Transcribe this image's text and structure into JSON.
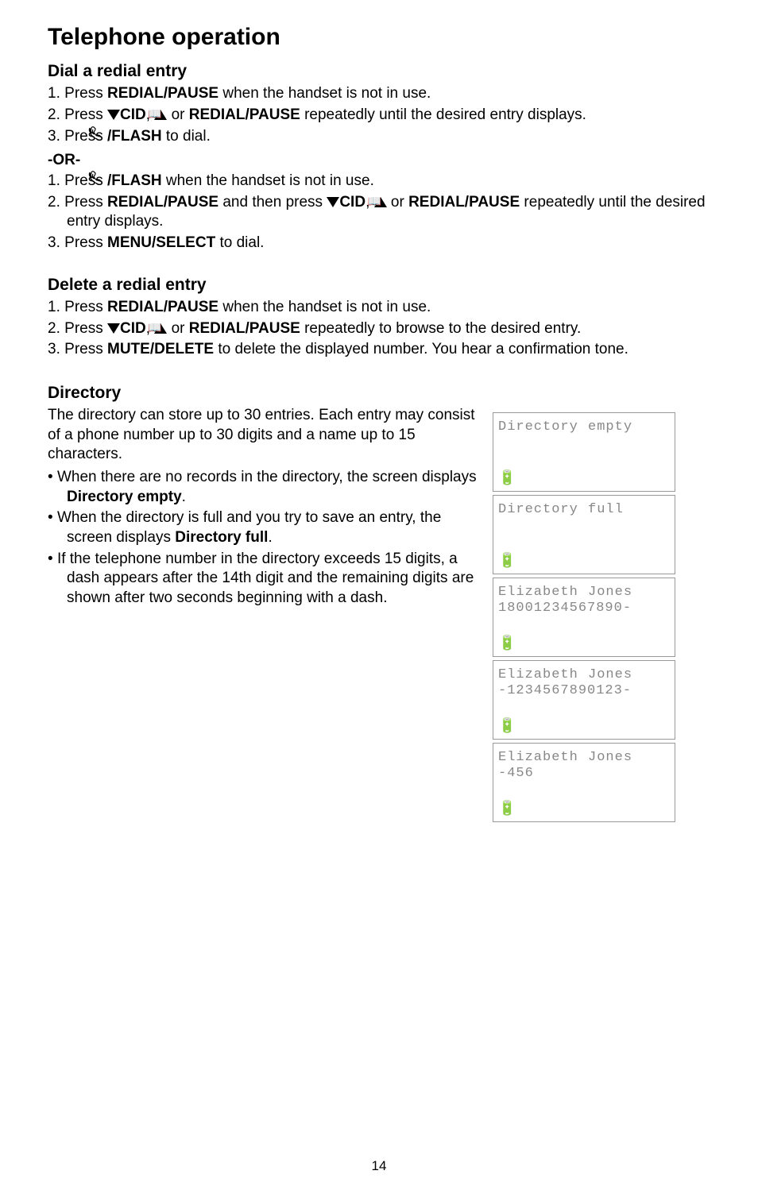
{
  "pageTitle": "Telephone operation",
  "sections": {
    "dialRedial": {
      "heading": "Dial a redial entry",
      "list1": [
        {
          "num": "1.",
          "pre": "Press ",
          "bold": "REDIAL/",
          "sc": "PAUSE",
          "post": " when the handset is not in use."
        },
        {
          "num": "2.",
          "pre": "Press ",
          "downArrow": true,
          "bold1": "CID",
          "mid": ", ",
          "upArrow": true,
          "book": true,
          "mid2": " or ",
          "bold2": "REDIAL/",
          "sc2": "PAUSE",
          "post": " repeatedly until the desired entry displays."
        },
        {
          "num": "3.",
          "pre": "Press ",
          "phone": true,
          "bold": "/",
          "sc": "FLASH",
          "post": " to dial."
        }
      ],
      "or": "-OR-",
      "list2": [
        {
          "num": "1.",
          "pre": "Press ",
          "phone": true,
          "bold": "/",
          "sc": "FLASH",
          "post": " when the handset is not in use."
        },
        {
          "num": "2.",
          "pre": "Press ",
          "bold": "REDIAL/",
          "sc": "PAUSE",
          "mid": " and then press ",
          "downArrow": true,
          "bold1": "CID",
          "mid2": ", ",
          "upArrow": true,
          "book": true,
          "mid3": " or ",
          "bold2": "REDIAL/",
          "sc2": "PAUSE",
          "post": " repeatedly until the desired entry displays."
        },
        {
          "num": "3.",
          "pre": "Press ",
          "sc": "MENU",
          "bold": "/SELECT",
          "post": " to dial."
        }
      ]
    },
    "deleteRedial": {
      "heading": "Delete a redial entry",
      "list": [
        {
          "num": "1.",
          "pre": "Press ",
          "bold": "REDIAL/",
          "sc": "PAUSE",
          "post": " when the handset is not in use."
        },
        {
          "num": "2.",
          "pre": "Press ",
          "downArrow": true,
          "bold1": "CID",
          "mid": ", ",
          "upArrow": true,
          "book": true,
          "mid2": " or ",
          "bold2": "REDIAL/",
          "sc2": "PAUSE",
          "post": " repeatedly to browse to the desired entry."
        },
        {
          "num": "3.",
          "pre": "Press ",
          "sc": "MUTE",
          "bold": "/DELETE",
          "post": " to delete the displayed number. You hear a confirmation tone."
        }
      ]
    },
    "directory": {
      "heading": "Directory",
      "intro": "The directory can store up to 30 entries. Each entry may consist of a phone number up to 30 digits and a name up to 15 characters.",
      "bullets": [
        {
          "pre": "When there are no records in the directory, the screen displays ",
          "bold": "Directory empty",
          "post": "."
        },
        {
          "pre": "When the directory is full and you try to save an entry, the screen displays ",
          "bold": "Directory full",
          "post": "."
        },
        {
          "pre": "If the telephone number in the directory exceeds 15 digits, a dash appears after the 14th digit and the remaining digits are shown after two seconds beginning with a dash.",
          "bold": "",
          "post": ""
        }
      ]
    }
  },
  "screens": [
    {
      "line1": "Directory empty",
      "line2": ""
    },
    {
      "line1": "Directory full",
      "line2": ""
    },
    {
      "line1": "Elizabeth Jones",
      "line2": "18001234567890-"
    },
    {
      "line1": "Elizabeth Jones",
      "line2": "-1234567890123-"
    },
    {
      "line1": "Elizabeth Jones",
      "line2": "-456"
    }
  ],
  "pageNumber": "14"
}
